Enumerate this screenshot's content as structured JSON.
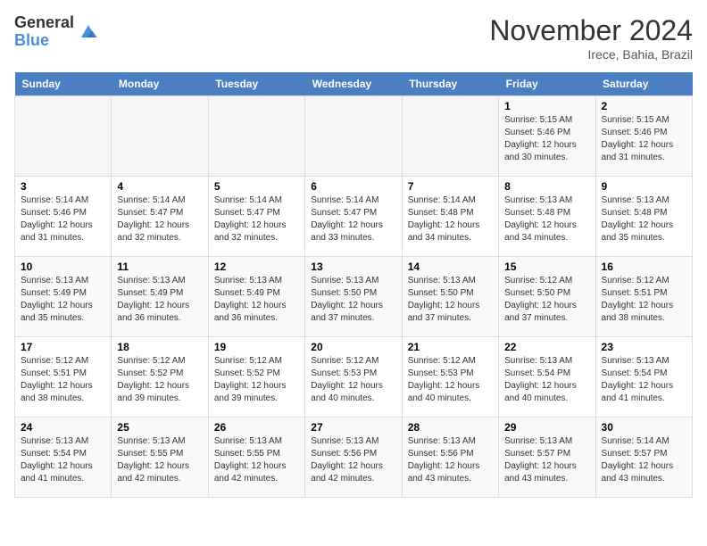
{
  "logo": {
    "general": "General",
    "blue": "Blue"
  },
  "header": {
    "month_title": "November 2024",
    "subtitle": "Irece, Bahia, Brazil"
  },
  "weekdays": [
    "Sunday",
    "Monday",
    "Tuesday",
    "Wednesday",
    "Thursday",
    "Friday",
    "Saturday"
  ],
  "weeks": [
    [
      {
        "day": "",
        "sunrise": "",
        "sunset": "",
        "daylight": ""
      },
      {
        "day": "",
        "sunrise": "",
        "sunset": "",
        "daylight": ""
      },
      {
        "day": "",
        "sunrise": "",
        "sunset": "",
        "daylight": ""
      },
      {
        "day": "",
        "sunrise": "",
        "sunset": "",
        "daylight": ""
      },
      {
        "day": "",
        "sunrise": "",
        "sunset": "",
        "daylight": ""
      },
      {
        "day": "1",
        "sunrise": "Sunrise: 5:15 AM",
        "sunset": "Sunset: 5:46 PM",
        "daylight": "Daylight: 12 hours and 30 minutes."
      },
      {
        "day": "2",
        "sunrise": "Sunrise: 5:15 AM",
        "sunset": "Sunset: 5:46 PM",
        "daylight": "Daylight: 12 hours and 31 minutes."
      }
    ],
    [
      {
        "day": "3",
        "sunrise": "Sunrise: 5:14 AM",
        "sunset": "Sunset: 5:46 PM",
        "daylight": "Daylight: 12 hours and 31 minutes."
      },
      {
        "day": "4",
        "sunrise": "Sunrise: 5:14 AM",
        "sunset": "Sunset: 5:47 PM",
        "daylight": "Daylight: 12 hours and 32 minutes."
      },
      {
        "day": "5",
        "sunrise": "Sunrise: 5:14 AM",
        "sunset": "Sunset: 5:47 PM",
        "daylight": "Daylight: 12 hours and 32 minutes."
      },
      {
        "day": "6",
        "sunrise": "Sunrise: 5:14 AM",
        "sunset": "Sunset: 5:47 PM",
        "daylight": "Daylight: 12 hours and 33 minutes."
      },
      {
        "day": "7",
        "sunrise": "Sunrise: 5:14 AM",
        "sunset": "Sunset: 5:48 PM",
        "daylight": "Daylight: 12 hours and 34 minutes."
      },
      {
        "day": "8",
        "sunrise": "Sunrise: 5:13 AM",
        "sunset": "Sunset: 5:48 PM",
        "daylight": "Daylight: 12 hours and 34 minutes."
      },
      {
        "day": "9",
        "sunrise": "Sunrise: 5:13 AM",
        "sunset": "Sunset: 5:48 PM",
        "daylight": "Daylight: 12 hours and 35 minutes."
      }
    ],
    [
      {
        "day": "10",
        "sunrise": "Sunrise: 5:13 AM",
        "sunset": "Sunset: 5:49 PM",
        "daylight": "Daylight: 12 hours and 35 minutes."
      },
      {
        "day": "11",
        "sunrise": "Sunrise: 5:13 AM",
        "sunset": "Sunset: 5:49 PM",
        "daylight": "Daylight: 12 hours and 36 minutes."
      },
      {
        "day": "12",
        "sunrise": "Sunrise: 5:13 AM",
        "sunset": "Sunset: 5:49 PM",
        "daylight": "Daylight: 12 hours and 36 minutes."
      },
      {
        "day": "13",
        "sunrise": "Sunrise: 5:13 AM",
        "sunset": "Sunset: 5:50 PM",
        "daylight": "Daylight: 12 hours and 37 minutes."
      },
      {
        "day": "14",
        "sunrise": "Sunrise: 5:13 AM",
        "sunset": "Sunset: 5:50 PM",
        "daylight": "Daylight: 12 hours and 37 minutes."
      },
      {
        "day": "15",
        "sunrise": "Sunrise: 5:12 AM",
        "sunset": "Sunset: 5:50 PM",
        "daylight": "Daylight: 12 hours and 37 minutes."
      },
      {
        "day": "16",
        "sunrise": "Sunrise: 5:12 AM",
        "sunset": "Sunset: 5:51 PM",
        "daylight": "Daylight: 12 hours and 38 minutes."
      }
    ],
    [
      {
        "day": "17",
        "sunrise": "Sunrise: 5:12 AM",
        "sunset": "Sunset: 5:51 PM",
        "daylight": "Daylight: 12 hours and 38 minutes."
      },
      {
        "day": "18",
        "sunrise": "Sunrise: 5:12 AM",
        "sunset": "Sunset: 5:52 PM",
        "daylight": "Daylight: 12 hours and 39 minutes."
      },
      {
        "day": "19",
        "sunrise": "Sunrise: 5:12 AM",
        "sunset": "Sunset: 5:52 PM",
        "daylight": "Daylight: 12 hours and 39 minutes."
      },
      {
        "day": "20",
        "sunrise": "Sunrise: 5:12 AM",
        "sunset": "Sunset: 5:53 PM",
        "daylight": "Daylight: 12 hours and 40 minutes."
      },
      {
        "day": "21",
        "sunrise": "Sunrise: 5:12 AM",
        "sunset": "Sunset: 5:53 PM",
        "daylight": "Daylight: 12 hours and 40 minutes."
      },
      {
        "day": "22",
        "sunrise": "Sunrise: 5:13 AM",
        "sunset": "Sunset: 5:54 PM",
        "daylight": "Daylight: 12 hours and 40 minutes."
      },
      {
        "day": "23",
        "sunrise": "Sunrise: 5:13 AM",
        "sunset": "Sunset: 5:54 PM",
        "daylight": "Daylight: 12 hours and 41 minutes."
      }
    ],
    [
      {
        "day": "24",
        "sunrise": "Sunrise: 5:13 AM",
        "sunset": "Sunset: 5:54 PM",
        "daylight": "Daylight: 12 hours and 41 minutes."
      },
      {
        "day": "25",
        "sunrise": "Sunrise: 5:13 AM",
        "sunset": "Sunset: 5:55 PM",
        "daylight": "Daylight: 12 hours and 42 minutes."
      },
      {
        "day": "26",
        "sunrise": "Sunrise: 5:13 AM",
        "sunset": "Sunset: 5:55 PM",
        "daylight": "Daylight: 12 hours and 42 minutes."
      },
      {
        "day": "27",
        "sunrise": "Sunrise: 5:13 AM",
        "sunset": "Sunset: 5:56 PM",
        "daylight": "Daylight: 12 hours and 42 minutes."
      },
      {
        "day": "28",
        "sunrise": "Sunrise: 5:13 AM",
        "sunset": "Sunset: 5:56 PM",
        "daylight": "Daylight: 12 hours and 43 minutes."
      },
      {
        "day": "29",
        "sunrise": "Sunrise: 5:13 AM",
        "sunset": "Sunset: 5:57 PM",
        "daylight": "Daylight: 12 hours and 43 minutes."
      },
      {
        "day": "30",
        "sunrise": "Sunrise: 5:14 AM",
        "sunset": "Sunset: 5:57 PM",
        "daylight": "Daylight: 12 hours and 43 minutes."
      }
    ]
  ]
}
